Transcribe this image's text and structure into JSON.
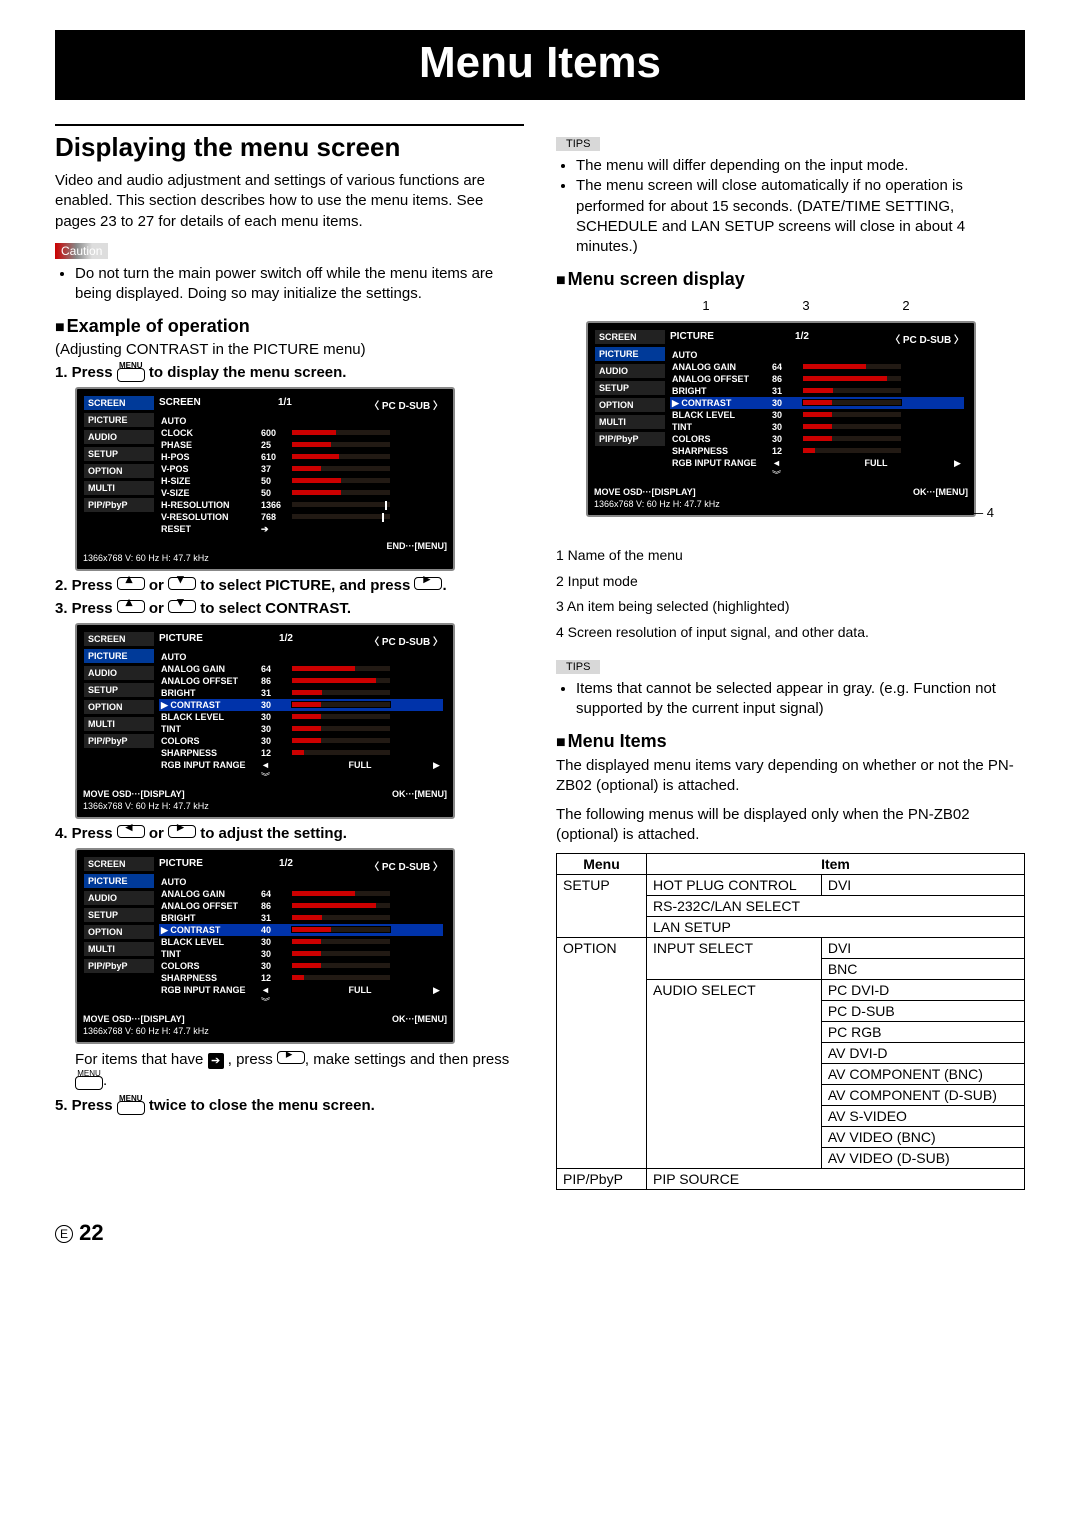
{
  "page": {
    "title": "Menu Items",
    "number": "22"
  },
  "left": {
    "h1": "Displaying the menu screen",
    "intro": "Video and audio adjustment and settings of various functions are enabled. This section describes how to use the menu items. See pages 23 to 27 for details of each menu items.",
    "caution_label": "Caution",
    "caution_text": "Do not turn the main power switch off while the menu items are being displayed. Doing so may initialize the settings.",
    "h2_example": "Example of operation",
    "example_sub": "(Adjusting CONTRAST in the PICTURE menu)",
    "step1_a": "1.  Press",
    "step1_menu": "MENU",
    "step1_b": "to display the menu screen.",
    "step2_a": "2.  Press",
    "step2_or": "or",
    "step2_b": "to select PICTURE, and press",
    "step2_end": ".",
    "step3_a": "3.  Press",
    "step3_b": "to select CONTRAST.",
    "step4_a": "4.  Press",
    "step4_b": "to adjust the setting.",
    "step4_note_a": "For items that have",
    "step4_note_b": ", press",
    "step4_note_c": ", make settings and then press",
    "step4_note_d": ".",
    "step5_a": "5.  Press",
    "step5_b": "twice to close the menu screen.",
    "osd_side": [
      "SCREEN",
      "PICTURE",
      "AUDIO",
      "SETUP",
      "OPTION",
      "MULTI",
      "PIP/PbyP"
    ],
    "osd1": {
      "title": "SCREEN",
      "page": "1/1",
      "mode": "PC D-SUB",
      "rows": [
        {
          "lbl": "AUTO",
          "val": null,
          "bar": null
        },
        {
          "lbl": "CLOCK",
          "val": "600",
          "bar": 45
        },
        {
          "lbl": "PHASE",
          "val": "25",
          "bar": 40
        },
        {
          "lbl": "H-POS",
          "val": "610",
          "bar": 48
        },
        {
          "lbl": "V-POS",
          "val": "37",
          "bar": 30
        },
        {
          "lbl": "H-SIZE",
          "val": "50",
          "bar": 50
        },
        {
          "lbl": "V-SIZE",
          "val": "50",
          "bar": 50
        },
        {
          "lbl": "H-RESOLUTION",
          "val": "1366",
          "bar": null,
          "tick": 95
        },
        {
          "lbl": "V-RESOLUTION",
          "val": "768",
          "bar": null,
          "tick": 92
        },
        {
          "lbl": "RESET",
          "val": "➔",
          "bar": null
        }
      ],
      "foot_right": "END···[MENU]",
      "foot_info": "1366x768        V: 60 Hz    H: 47.7 kHz"
    },
    "osd2": {
      "title": "PICTURE",
      "page": "1/2",
      "mode": "PC D-SUB",
      "rows": [
        {
          "lbl": "AUTO",
          "val": null,
          "bar": null
        },
        {
          "lbl": "ANALOG GAIN",
          "val": "64",
          "bar": 64
        },
        {
          "lbl": "ANALOG OFFSET",
          "val": "86",
          "bar": 86
        },
        {
          "lbl": "BRIGHT",
          "val": "31",
          "bar": 31
        },
        {
          "lbl": "CONTRAST",
          "val": "30",
          "bar": 30,
          "hl": true
        },
        {
          "lbl": "BLACK LEVEL",
          "val": "30",
          "bar": 30
        },
        {
          "lbl": "TINT",
          "val": "30",
          "bar": 30
        },
        {
          "lbl": "COLORS",
          "val": "30",
          "bar": 30
        },
        {
          "lbl": "SHARPNESS",
          "val": "12",
          "bar": 12
        },
        {
          "lbl": "RGB INPUT RANGE",
          "val": "◄",
          "text": "FULL",
          "right": "▶"
        }
      ],
      "more": "︾",
      "foot_left": "MOVE OSD···[DISPLAY]",
      "foot_right": "OK···[MENU]",
      "foot_info": "1366x768        V: 60 Hz    H: 47.7 kHz"
    },
    "osd3_contrast": {
      "val": "40",
      "bar": 40
    }
  },
  "right": {
    "tips1_label": "TIPS",
    "tips1": [
      "The menu will differ depending on the input mode.",
      "The menu screen will close automatically if no operation is performed for about 15 seconds. (DATE/TIME SETTING, SCHEDULE and LAN SETUP screens will close in about 4 minutes.)"
    ],
    "h2_display": "Menu screen display",
    "call_nums": {
      "n1": "1",
      "n2": "2",
      "n3": "3",
      "n4": "4"
    },
    "legend": [
      "1  Name of the menu",
      "2  Input mode",
      "3  An item being selected (highlighted)",
      "4  Screen resolution of input signal, and other data."
    ],
    "tips2_label": "TIPS",
    "tips2": [
      "Items that cannot be selected appear in gray. (e.g. Function not supported by the current input signal)"
    ],
    "h2_items": "Menu Items",
    "items_intro1": "The displayed menu items vary depending on whether or not the PN-ZB02 (optional) is attached.",
    "items_intro2": "The following menus will be displayed only when the PN-ZB02 (optional) is attached.",
    "table": {
      "head": [
        "Menu",
        "Item"
      ],
      "rows": [
        {
          "menu": "SETUP",
          "item": "HOT PLUG CONTROL",
          "val": "DVI"
        },
        {
          "menu": "",
          "item": "RS-232C/LAN SELECT",
          "val": null
        },
        {
          "menu": "",
          "item": "LAN SETUP",
          "val": null
        },
        {
          "menu": "OPTION",
          "item": "INPUT SELECT",
          "val": "DVI"
        },
        {
          "menu": "",
          "item": "",
          "val": "BNC"
        },
        {
          "menu": "",
          "item": "AUDIO SELECT",
          "val": "PC DVI-D"
        },
        {
          "menu": "",
          "item": "",
          "val": "PC D-SUB"
        },
        {
          "menu": "",
          "item": "",
          "val": "PC RGB"
        },
        {
          "menu": "",
          "item": "",
          "val": "AV DVI-D"
        },
        {
          "menu": "",
          "item": "",
          "val": "AV COMPONENT (BNC)"
        },
        {
          "menu": "",
          "item": "",
          "val": "AV COMPONENT (D-SUB)"
        },
        {
          "menu": "",
          "item": "",
          "val": "AV S-VIDEO"
        },
        {
          "menu": "",
          "item": "",
          "val": "AV VIDEO (BNC)"
        },
        {
          "menu": "",
          "item": "",
          "val": "AV VIDEO (D-SUB)"
        },
        {
          "menu": "PIP/PbyP",
          "item": "PIP SOURCE",
          "val": null
        }
      ]
    }
  }
}
